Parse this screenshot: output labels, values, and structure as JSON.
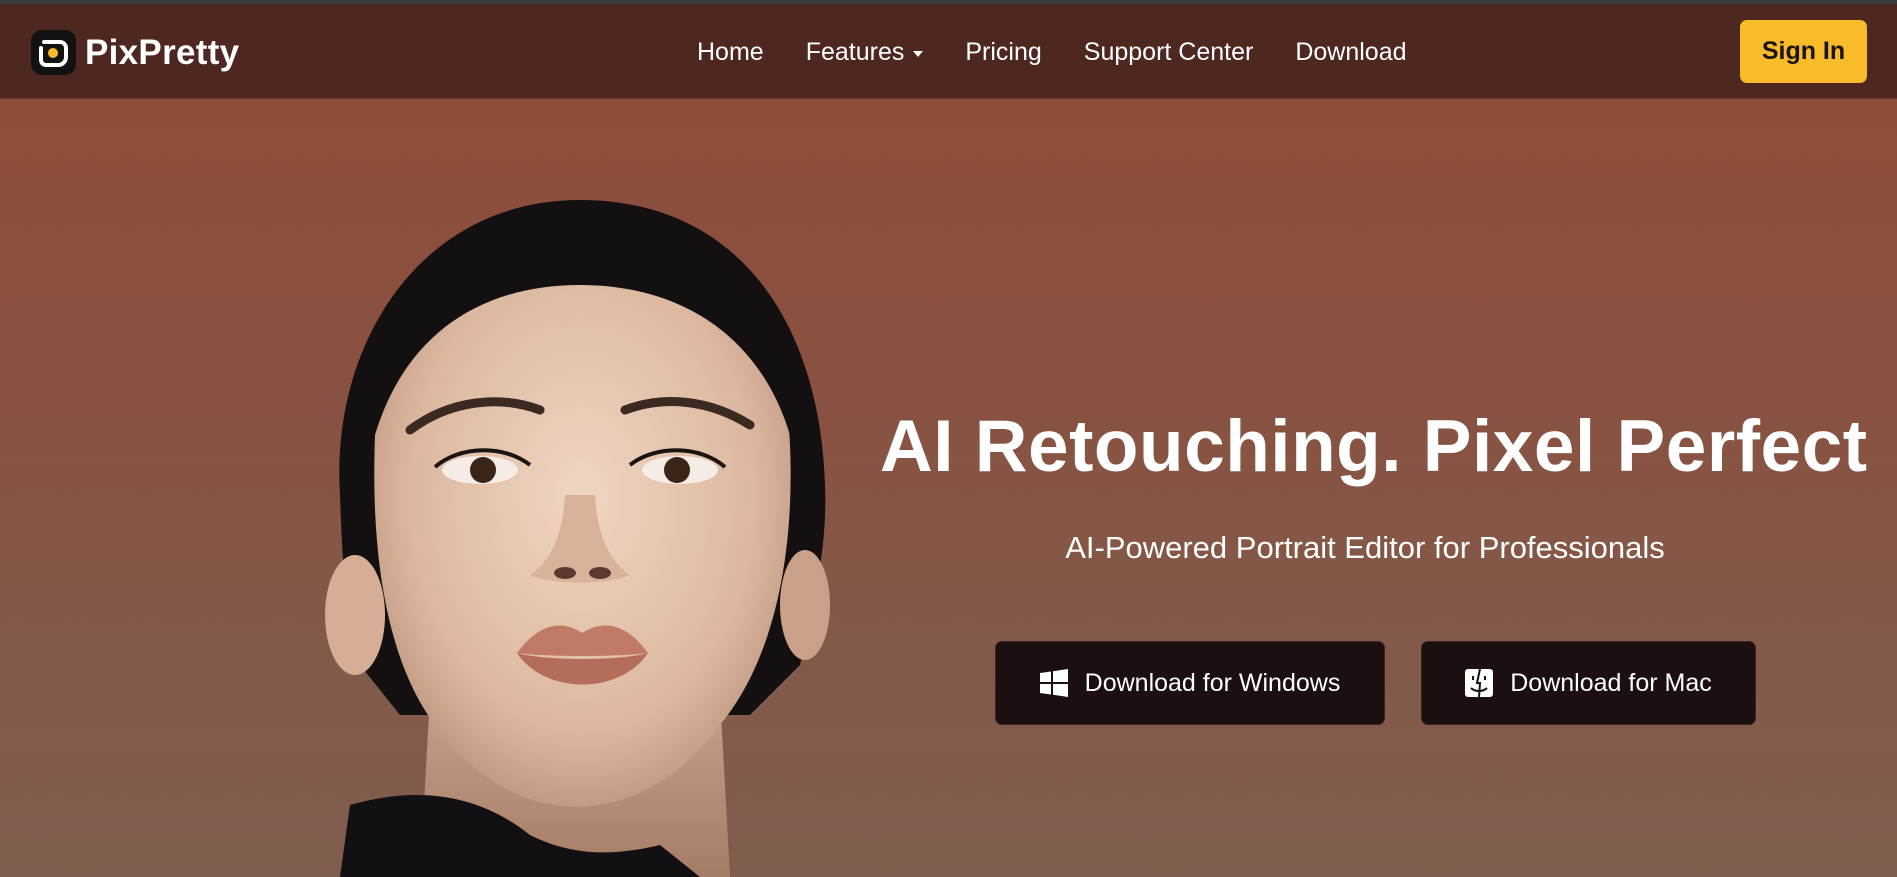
{
  "brand": {
    "name": "PixPretty"
  },
  "nav": {
    "home": "Home",
    "features": "Features",
    "pricing": "Pricing",
    "support": "Support Center",
    "download": "Download"
  },
  "signin": "Sign In",
  "hero": {
    "title": "AI Retouching. Pixel Perfect",
    "subtitle": "AI-Powered Portrait Editor for Professionals",
    "download_windows": "Download for Windows",
    "download_mac": "Download for Mac"
  },
  "colors": {
    "accent": "#f8bb2a",
    "nav_bg": "#4d2720",
    "button_bg": "#1b0f10"
  },
  "icons": [
    "logo-icon",
    "caret-down-icon",
    "windows-icon",
    "mac-finder-icon"
  ]
}
